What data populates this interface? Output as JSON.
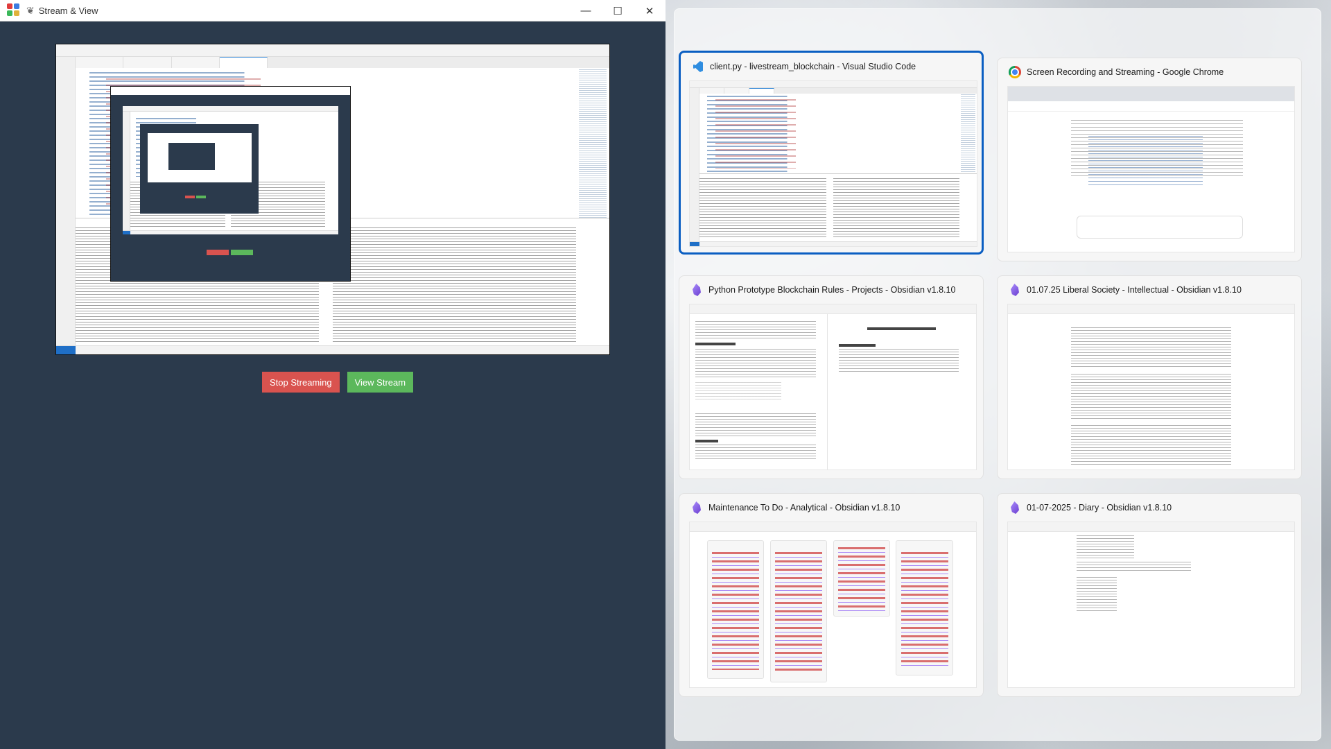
{
  "app": {
    "title": "Stream & View",
    "buttons": {
      "stop_label": "Stop Streaming",
      "view_label": "View Stream"
    },
    "colors": {
      "stop": "#d9534f",
      "view": "#5cb85c",
      "background": "#2b3a4c"
    },
    "controls": {
      "minimize": "—",
      "maximize": "☐",
      "close": "✕"
    }
  },
  "taskview": {
    "windows": [
      {
        "title": "client.py - livestream_blockchain - Visual Studio Code",
        "icon": "vscode-icon",
        "selected": true
      },
      {
        "title": "Screen Recording and Streaming - Google Chrome",
        "icon": "chrome-icon",
        "selected": false
      },
      {
        "title": "Python Prototype Blockchain Rules - Projects - Obsidian v1.8.10",
        "icon": "obsidian-icon",
        "selected": false
      },
      {
        "title": "01.07.25 Liberal Society - Intellectual - Obsidian v1.8.10",
        "icon": "obsidian-icon",
        "selected": false
      },
      {
        "title": "Maintenance To Do - Analytical - Obsidian v1.8.10",
        "icon": "obsidian-icon",
        "selected": false
      },
      {
        "title": "01-07-2025 - Diary - Obsidian v1.8.10",
        "icon": "obsidian-icon",
        "selected": false
      }
    ]
  }
}
